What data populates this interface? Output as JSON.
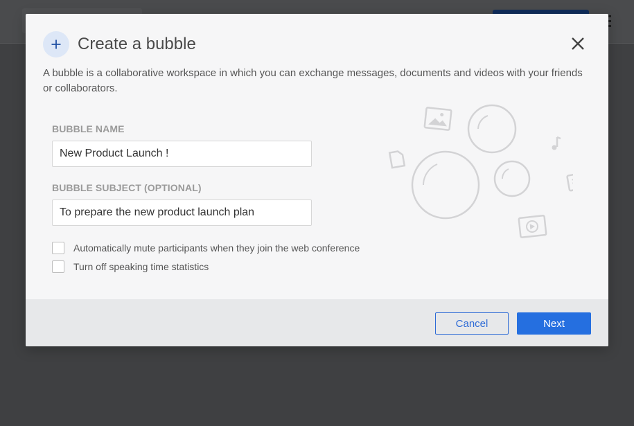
{
  "modal": {
    "title": "Create a bubble",
    "description": "A bubble is a collaborative workspace in which you can exchange messages, documents and videos with your friends or collaborators.",
    "bubble_name": {
      "label": "BUBBLE NAME",
      "value": "New Product Launch !"
    },
    "bubble_subject": {
      "label": "BUBBLE SUBJECT (OPTIONAL)",
      "value": "To prepare the new product launch plan"
    },
    "options": [
      {
        "label": "Automatically mute participants when they join the web conference",
        "checked": false
      },
      {
        "label": "Turn off speaking time statistics",
        "checked": false
      }
    ],
    "footer": {
      "cancel_label": "Cancel",
      "next_label": "Next"
    }
  },
  "colors": {
    "accent": "#256fe0",
    "overlay": "#3f4042",
    "modal_background": "#f6f6f7",
    "footer_background": "#e7e8ea"
  },
  "icons": {
    "title_icon": "plus-icon",
    "close": "close-icon",
    "illustration": "bubbles-illustration"
  }
}
